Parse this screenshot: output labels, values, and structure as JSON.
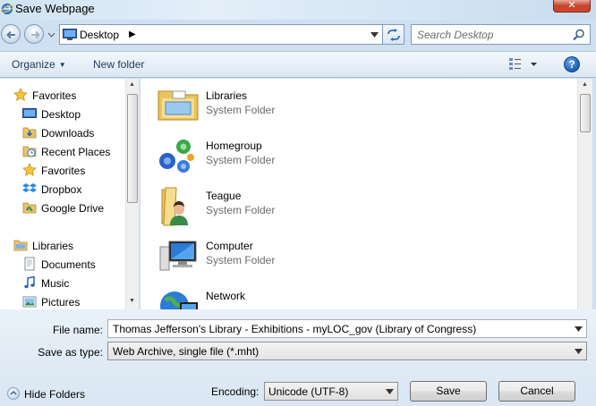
{
  "window": {
    "title": "Save Webpage"
  },
  "address": {
    "location": "Desktop"
  },
  "search": {
    "placeholder": "Search Desktop"
  },
  "toolbar": {
    "organize": "Organize",
    "new_folder": "New folder"
  },
  "nav": {
    "favorites": {
      "label": "Favorites",
      "items": [
        {
          "label": "Desktop",
          "icon": "desktop-icon"
        },
        {
          "label": "Downloads",
          "icon": "downloads-folder-icon"
        },
        {
          "label": "Recent Places",
          "icon": "recent-places-icon"
        },
        {
          "label": "Favorites",
          "icon": "star-icon"
        },
        {
          "label": "Dropbox",
          "icon": "dropbox-icon"
        },
        {
          "label": "Google Drive",
          "icon": "google-drive-folder-icon"
        }
      ]
    },
    "libraries": {
      "label": "Libraries",
      "items": [
        {
          "label": "Documents",
          "icon": "documents-icon"
        },
        {
          "label": "Music",
          "icon": "music-icon"
        },
        {
          "label": "Pictures",
          "icon": "pictures-icon"
        }
      ]
    }
  },
  "files": [
    {
      "name": "Libraries",
      "type": "System Folder",
      "icon": "libraries-icon"
    },
    {
      "name": "Homegroup",
      "type": "System Folder",
      "icon": "homegroup-icon"
    },
    {
      "name": "Teague",
      "type": "System Folder",
      "icon": "user-folder-icon"
    },
    {
      "name": "Computer",
      "type": "System Folder",
      "icon": "computer-icon"
    },
    {
      "name": "Network",
      "type": "",
      "icon": "network-icon"
    }
  ],
  "form": {
    "file_name_label": "File name:",
    "file_name_value": "Thomas Jefferson's Library -  Exhibitions - myLOC_gov (Library of Congress)",
    "save_type_label": "Save as type:",
    "save_type_value": "Web Archive, single file (*.mht)",
    "hide_folders": "Hide Folders",
    "encoding_label": "Encoding:",
    "encoding_value": "Unicode (UTF-8)",
    "save_button": "Save",
    "cancel_button": "Cancel"
  }
}
